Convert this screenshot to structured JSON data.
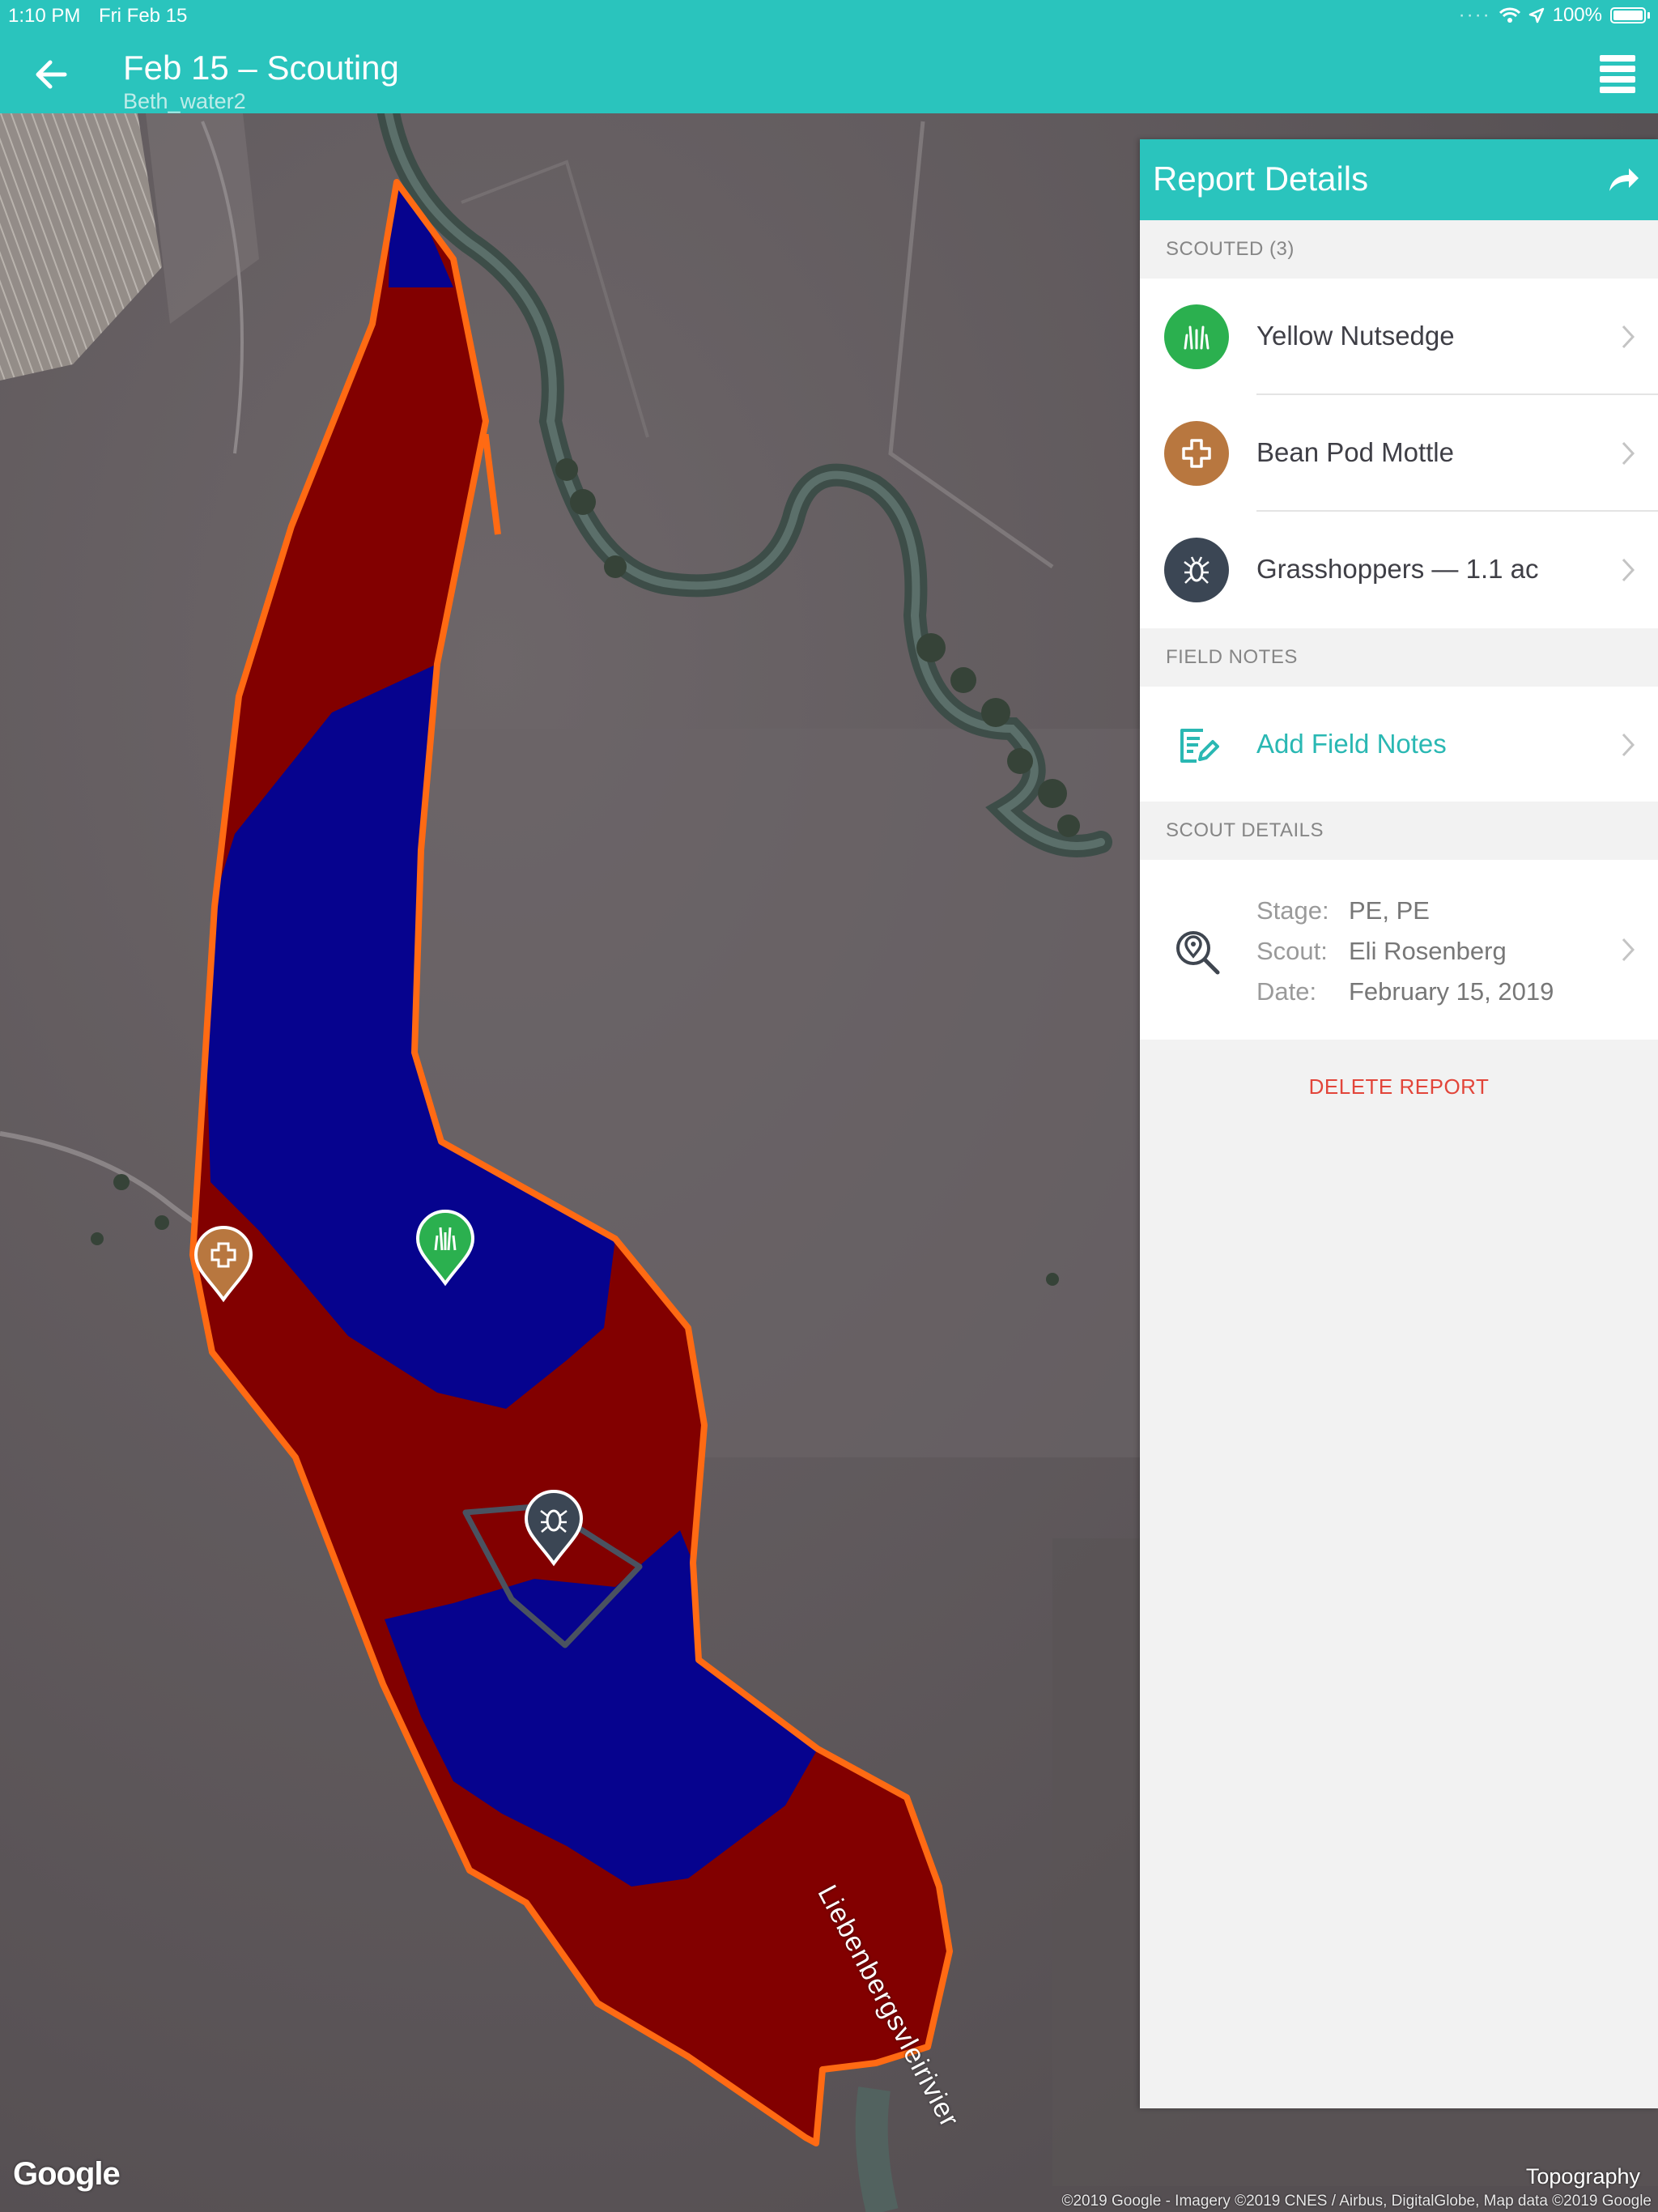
{
  "status_bar": {
    "time": "1:10 PM",
    "date": "Fri Feb 15",
    "battery": "100%"
  },
  "header": {
    "title": "Feb 15 – Scouting",
    "subtitle": "Beth_water2"
  },
  "map": {
    "river_label": "Liebenbergsvleirivier",
    "layer_label": "Topography",
    "logo_text": "Google",
    "credit": "©2019 Google - Imagery ©2019 CNES / Airbus, DigitalGlobe, Map data ©2019 Google",
    "zone_colors": {
      "high": "#820000",
      "low": "#06038e",
      "boundary": "#ff6a13"
    },
    "markers": [
      {
        "name": "bean-pod-mottle-marker",
        "color": "#b8773f"
      },
      {
        "name": "yellow-nutsedge-marker",
        "color": "#2bb04f"
      },
      {
        "name": "grasshoppers-marker",
        "color": "#3b4654"
      }
    ]
  },
  "report": {
    "title": "Report Details",
    "scouted_label": "SCOUTED (3)",
    "scouted_items": [
      {
        "label": "Yellow Nutsedge",
        "icon": "weed-icon",
        "color": "#2bb04f"
      },
      {
        "label": "Bean Pod Mottle",
        "icon": "disease-cross-icon",
        "color": "#b8773f"
      },
      {
        "label": "Grasshoppers — 1.1 ac",
        "icon": "insect-icon",
        "color": "#3b4654"
      }
    ],
    "field_notes_label": "FIELD NOTES",
    "add_field_notes": "Add Field Notes",
    "scout_details_label": "SCOUT DETAILS",
    "scout_details": {
      "stage_key": "Stage:",
      "stage_value": "PE, PE",
      "scout_key": "Scout:",
      "scout_value": "Eli Rosenberg",
      "date_key": "Date:",
      "date_value": "February 15, 2019"
    },
    "delete_label": "DELETE REPORT"
  },
  "colors": {
    "accent": "#2ac4bd",
    "delete": "#e2453a"
  }
}
